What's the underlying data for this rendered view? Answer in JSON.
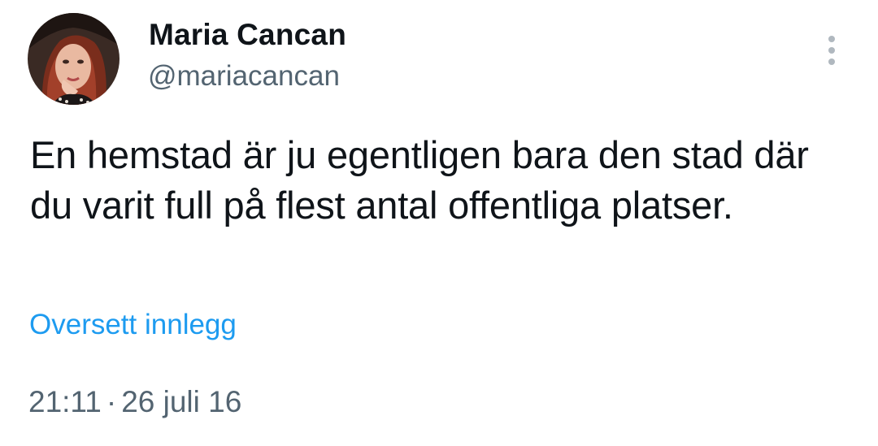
{
  "author": {
    "name": "Maria Cancan",
    "handle": "@mariacancan",
    "avatar_icon": "profile-photo"
  },
  "tweet": {
    "text": "En hemstad är ju egentligen bara den stad där du varit full på flest antal offentliga platser.",
    "translate_label": "Oversett innlegg",
    "time": "21:11",
    "separator": "·",
    "date": "26 juli 16"
  },
  "more_menu": {
    "icon": "vertical-dots-icon"
  },
  "colors": {
    "text_primary": "#0f1419",
    "text_secondary": "#536471",
    "link": "#1d9bf0",
    "background": "#ffffff"
  }
}
